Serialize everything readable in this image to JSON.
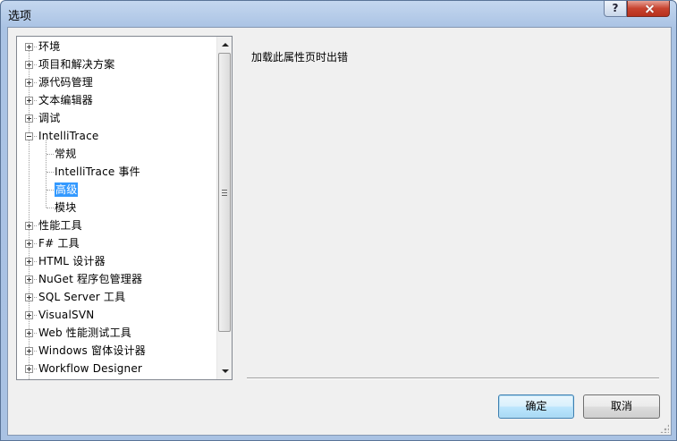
{
  "window": {
    "title": "选项",
    "help_symbol": "?"
  },
  "tree": {
    "items": [
      {
        "label": "环境",
        "level": 0,
        "expander": "plus"
      },
      {
        "label": "项目和解决方案",
        "level": 0,
        "expander": "plus"
      },
      {
        "label": "源代码管理",
        "level": 0,
        "expander": "plus"
      },
      {
        "label": "文本编辑器",
        "level": 0,
        "expander": "plus"
      },
      {
        "label": "调试",
        "level": 0,
        "expander": "plus"
      },
      {
        "label": "IntelliTrace",
        "level": 0,
        "expander": "minus"
      },
      {
        "label": "常规",
        "level": 1
      },
      {
        "label": "IntelliTrace 事件",
        "level": 1
      },
      {
        "label": "高级",
        "level": 1,
        "selected": true
      },
      {
        "label": "模块",
        "level": 1
      },
      {
        "label": "性能工具",
        "level": 0,
        "expander": "plus"
      },
      {
        "label": "F# 工具",
        "level": 0,
        "expander": "plus"
      },
      {
        "label": "HTML 设计器",
        "level": 0,
        "expander": "plus"
      },
      {
        "label": "NuGet 程序包管理器",
        "level": 0,
        "expander": "plus"
      },
      {
        "label": "SQL Server 工具",
        "level": 0,
        "expander": "plus"
      },
      {
        "label": "VisualSVN",
        "level": 0,
        "expander": "plus"
      },
      {
        "label": "Web 性能测试工具",
        "level": 0,
        "expander": "plus"
      },
      {
        "label": "Windows 窗体设计器",
        "level": 0,
        "expander": "plus"
      },
      {
        "label": "Workflow Designer",
        "level": 0,
        "expander": "plus"
      }
    ]
  },
  "content": {
    "message": "加载此属性页时出错"
  },
  "buttons": {
    "ok": "确定",
    "cancel": "取消"
  },
  "colors": {
    "selection": "#3399ff",
    "default_button_border": "#3c7fb1"
  }
}
